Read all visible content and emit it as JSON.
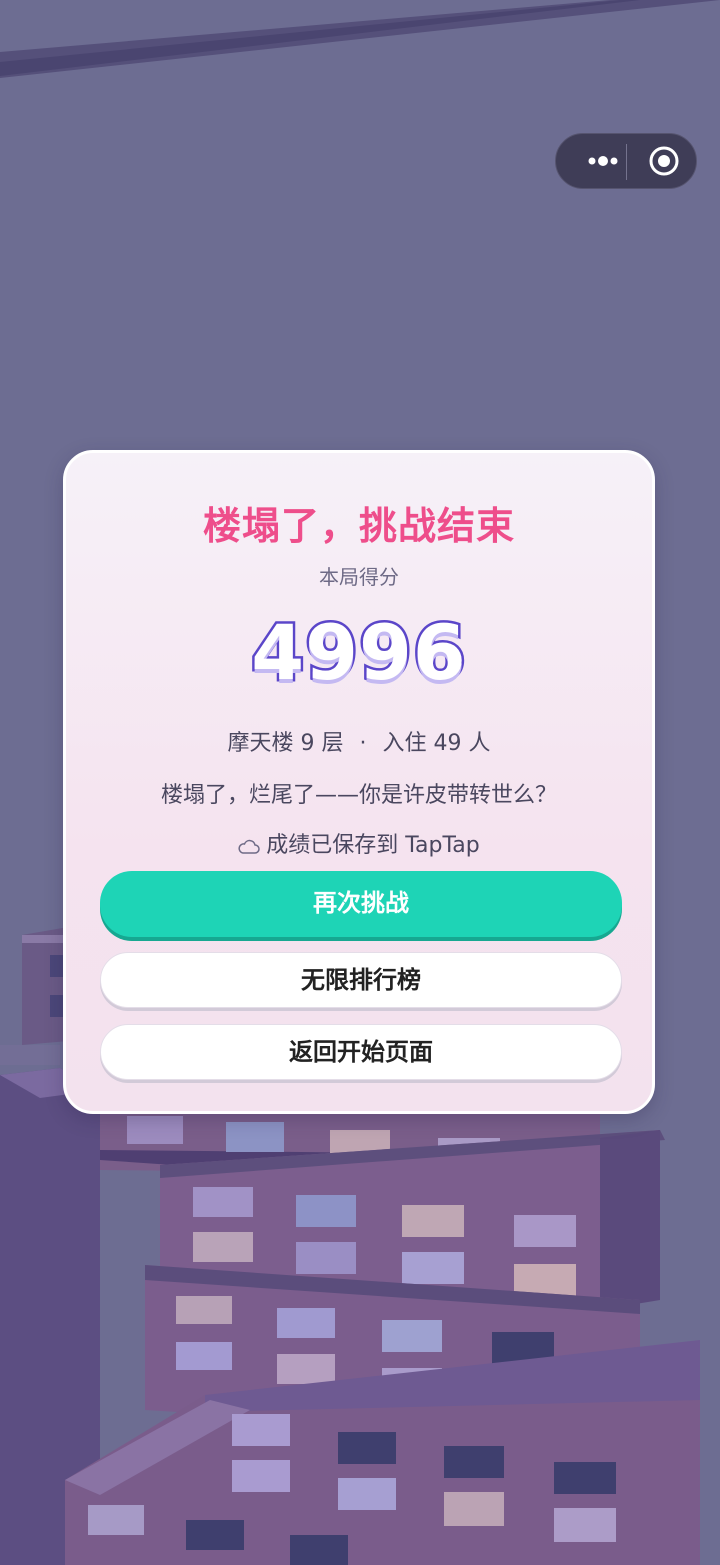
{
  "menu": {
    "more_icon": "more-dots-icon",
    "close_icon": "circle-target-icon"
  },
  "dialog": {
    "title": "楼塌了，挑战结束",
    "subtitle": "本局得分",
    "score": "4996",
    "floors": "摩天楼 9 层",
    "separator": "·",
    "residents": "入住 49 人",
    "quote": "楼塌了，烂尾了——你是许皮带转世么？",
    "saved_icon": "cloud-icon",
    "saved_text": "成绩已保存到 TapTap",
    "retry_label": "再次挑战",
    "leaderboard_label": "无限排行榜",
    "home_label": "返回开始页面"
  },
  "colors": {
    "background": "#6d6d92",
    "title": "#ee4e8b",
    "score_outline": "#5b46c9",
    "primary_button": "#1ed4b6"
  }
}
